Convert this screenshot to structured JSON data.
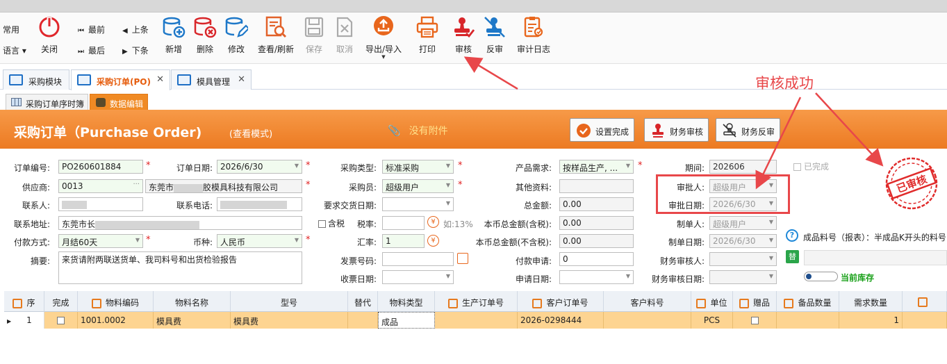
{
  "ribbon": {
    "left_items": [
      "常用",
      "语言 ▾"
    ],
    "close_label": "关闭",
    "nav": {
      "first": "最前",
      "last": "最后",
      "prev": "上条",
      "next": "下条"
    },
    "buttons": [
      {
        "label": "新增",
        "icon": "add-db-icon"
      },
      {
        "label": "删除",
        "icon": "delete-db-icon"
      },
      {
        "label": "修改",
        "icon": "edit-db-icon"
      },
      {
        "label": "查看/刷新",
        "icon": "view-refresh-icon"
      },
      {
        "label": "保存",
        "icon": "save-icon"
      },
      {
        "label": "取消",
        "icon": "cancel-icon"
      },
      {
        "label": "导出/导入",
        "icon": "export-import-icon"
      },
      {
        "label": "打印",
        "icon": "printer-icon"
      },
      {
        "label": "审核",
        "icon": "approve-stamp-icon"
      },
      {
        "label": "反审",
        "icon": "unapprove-stamp-icon"
      },
      {
        "label": "审计日志",
        "icon": "audit-log-icon"
      }
    ]
  },
  "tabs": [
    {
      "label": "采购模块",
      "closable": false
    },
    {
      "label": "采购订单(PO)",
      "closable": true
    },
    {
      "label": "模具管理",
      "closable": true
    }
  ],
  "subtabs": [
    {
      "label": "采购订单序时簿"
    },
    {
      "label": "数据编辑"
    }
  ],
  "header": {
    "title": "采购订单（Purchase Order)",
    "mode": "(查看模式)",
    "attachment": "没有附件",
    "btn_complete": "设置完成",
    "btn_fin_approve": "财务审核",
    "btn_fin_unapprove": "财务反审"
  },
  "form": {
    "order_no": {
      "label": "订单编号:",
      "value": "PO260601884"
    },
    "order_date": {
      "label": "订单日期:",
      "value": "2026/6/30"
    },
    "purchase_type": {
      "label": "采购类型:",
      "value": "标准采购"
    },
    "product_need": {
      "label": "产品需求:",
      "value": "按样品生产, ..."
    },
    "period": {
      "label": "期间:",
      "value": "202606"
    },
    "completed": {
      "label": "已完成"
    },
    "supplier": {
      "label": "供应商:",
      "code": "0013",
      "name_prefix": "东莞市",
      "name_suffix": "胶模具科技有限公司"
    },
    "buyer": {
      "label": "采购员:",
      "value": "超级用户"
    },
    "other_info": {
      "label": "其他资料:",
      "value": ""
    },
    "approver": {
      "label": "审批人:",
      "value": "超级用户"
    },
    "contact": {
      "label": "联系人:"
    },
    "phone": {
      "label": "联系电话:"
    },
    "delivery_date": {
      "label": "要求交货日期:",
      "value": ""
    },
    "total": {
      "label": "总金额:",
      "value": "0.00"
    },
    "approve_date": {
      "label": "审批日期:",
      "value": "2026/6/30"
    },
    "address": {
      "label": "联系地址:",
      "value": "东莞市长"
    },
    "tax_incl": {
      "label": "含税"
    },
    "tax_rate": {
      "label": "税率:",
      "hint": "如:13%"
    },
    "local_total_tax": {
      "label": "本币总金额(含税):",
      "value": "0.00"
    },
    "creator": {
      "label": "制单人:",
      "value": "超级用户"
    },
    "payment": {
      "label": "付款方式:",
      "value": "月结60天"
    },
    "currency": {
      "label": "币种:",
      "value": "人民币"
    },
    "exchange_rate": {
      "label": "汇率:",
      "value": "1"
    },
    "local_total_notax": {
      "label": "本币总金额(不含税):",
      "value": "0.00"
    },
    "create_date": {
      "label": "制单日期:",
      "value": "2026/6/30"
    },
    "summary": {
      "label": "摘要:",
      "value": "来货请附两联送货单、我司料号和出货检验报告"
    },
    "invoice_no": {
      "label": "发票号码:",
      "value": ""
    },
    "pay_request": {
      "label": "付款申请:",
      "value": "0"
    },
    "fin_approver": {
      "label": "财务审核人:",
      "value": ""
    },
    "receive_date": {
      "label": "收票日期:",
      "value": ""
    },
    "apply_date": {
      "label": "申请日期:",
      "value": ""
    },
    "fin_approve_date": {
      "label": "财务审核日期:",
      "value": ""
    },
    "finished_note": "成品料号（报表）：半成品K开头的料号",
    "stock_label": "当前库存",
    "stamp_text": "已审核"
  },
  "grid": {
    "headers": [
      "序",
      "完成",
      "物料编码",
      "物料名称",
      "型号",
      "替代",
      "物料类型",
      "生产订单号",
      "客户订单号",
      "客户料号",
      "单位",
      "赠品",
      "备品数量",
      "需求数量",
      ""
    ],
    "rows": [
      {
        "seq": "1",
        "code": "1001.0002",
        "name": "模具费",
        "model": "模具费",
        "type": "成品",
        "cust_order": "2026-0298444",
        "unit": "PCS",
        "qty": "1"
      }
    ]
  },
  "annotation": {
    "text": "审核成功",
    "color": "#e8474a"
  },
  "colors": {
    "accent": "#f08a24",
    "header": "#ec7a22",
    "row_selected": "#fdd491",
    "annotation": "#e8474a"
  }
}
